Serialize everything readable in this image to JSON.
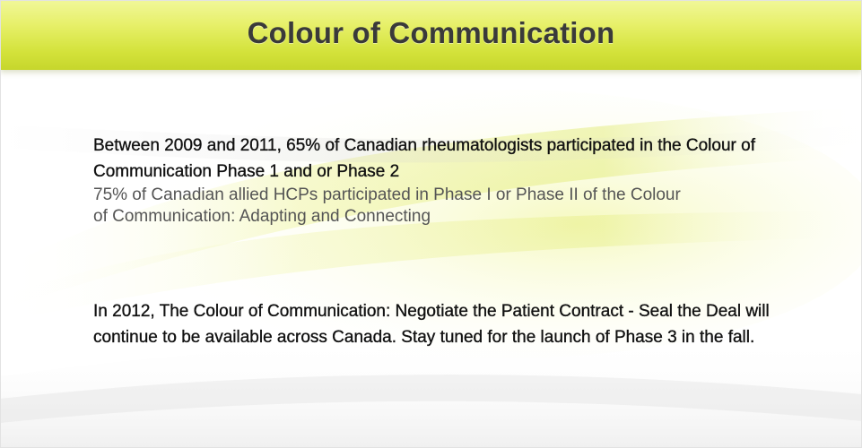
{
  "header": {
    "title": "Colour of Communication"
  },
  "content": {
    "statement_1": "Between 2009 and 2011, 65% of Canadian rheumatologists participated in the Colour of Communication Phase 1 and or Phase 2",
    "statement_2": "75% of Canadian allied HCPs participated in Phase I or Phase II of the Colour of Communication: Adapting and Connecting",
    "statement_3": "In 2012, The Colour of Communication: Negotiate the Patient Contract - Seal the Deal will continue to be available across Canada. Stay tuned for the launch of Phase 3 in the fall."
  },
  "colors": {
    "header_top": "#f1f79a",
    "header_bottom": "#c6d62c",
    "title_text": "#3a3a3a",
    "body_text": "#111111",
    "secondary_text": "#555555",
    "swoosh_tint": "#e8f07a"
  }
}
